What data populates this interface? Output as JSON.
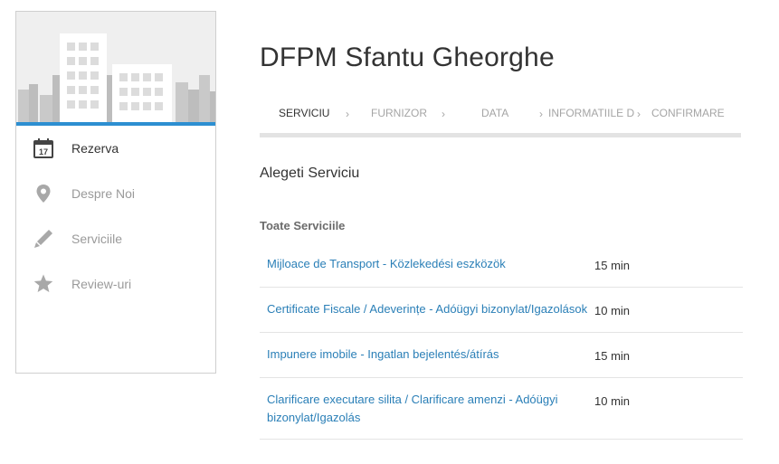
{
  "sidebar": {
    "items": [
      {
        "label": "Rezerva",
        "icon": "calendar-icon",
        "active": true
      },
      {
        "label": "Despre Noi",
        "icon": "map-pin-icon",
        "active": false
      },
      {
        "label": "Serviciile",
        "icon": "pencil-icon",
        "active": false
      },
      {
        "label": "Review-uri",
        "icon": "star-icon",
        "active": false
      }
    ],
    "calendar_day": "17",
    "accent_color": "#2d8fd1"
  },
  "header": {
    "title": "DFPM Sfantu Gheorghe"
  },
  "steps": [
    {
      "label": "SERVICIU",
      "active": true
    },
    {
      "label": "FURNIZOR",
      "active": false
    },
    {
      "label": "DATA",
      "active": false
    },
    {
      "label": "INFORMATIILE D",
      "active": false
    },
    {
      "label": "CONFIRMARE",
      "active": false
    }
  ],
  "content": {
    "section_title": "Alegeti Serviciu",
    "group_title": "Toate Serviciile",
    "services": [
      {
        "name": "Mijloace de Transport - Közlekedési eszközök",
        "duration": "15 min"
      },
      {
        "name": "Certificate Fiscale / Adeverințe - Adóügyi bizonylat/Igazolások",
        "duration": "10 min"
      },
      {
        "name": "Impunere imobile - Ingatlan bejelentés/átírás",
        "duration": "15 min"
      },
      {
        "name": "Clarificare executare silita / Clarificare amenzi - Adóügyi bizonylat/Igazolás",
        "duration": "10 min"
      }
    ]
  },
  "colors": {
    "link": "#2a7fb7",
    "muted": "#9a9a9a"
  }
}
